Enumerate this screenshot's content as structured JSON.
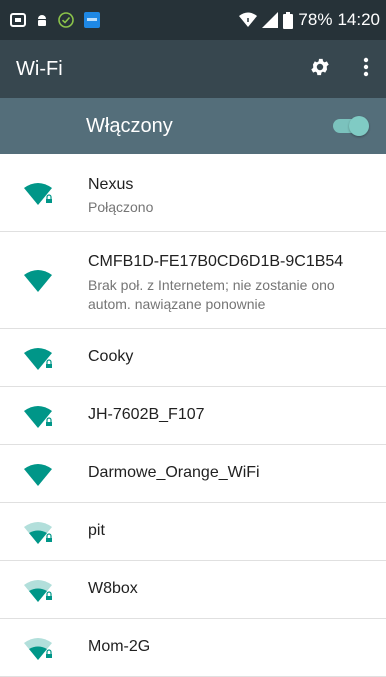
{
  "statusbar": {
    "battery": "78%",
    "time": "14:20"
  },
  "toolbar": {
    "title": "Wi-Fi"
  },
  "toggle": {
    "label": "Włączony",
    "state": "on"
  },
  "colors": {
    "accent": "#009688",
    "weak_signal": "#80cbc4",
    "statusbar": "#263238",
    "toolbar": "#37474f",
    "switchbar": "#546e7a"
  },
  "networks": [
    {
      "ssid": "Nexus",
      "status": "Połączono",
      "secured": true,
      "signal": 4
    },
    {
      "ssid": "CMFB1D-FE17B0CD6D1B-9C1B54",
      "status": "Brak poł. z Internetem; nie zostanie ono autom. nawiązane ponownie",
      "secured": false,
      "signal": 4
    },
    {
      "ssid": "Cooky",
      "secured": true,
      "signal": 4
    },
    {
      "ssid": "JH-7602B_F107",
      "secured": true,
      "signal": 4
    },
    {
      "ssid": "Darmowe_Orange_WiFi",
      "secured": false,
      "signal": 4
    },
    {
      "ssid": "pit",
      "secured": true,
      "signal": 2
    },
    {
      "ssid": "W8box",
      "secured": true,
      "signal": 2
    },
    {
      "ssid": "Mom-2G",
      "secured": true,
      "signal": 2
    }
  ]
}
